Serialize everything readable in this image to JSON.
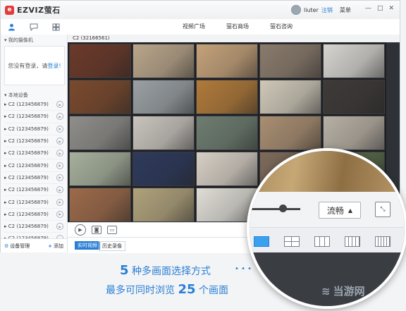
{
  "app": {
    "logo": "EZVIZ萤石",
    "username": "liuter",
    "logout": "注销",
    "menu": "菜单",
    "window_buttons": [
      "—",
      "□",
      "✕"
    ]
  },
  "nav": {
    "tabs": [
      "视频广场",
      "萤石商场",
      "萤石咨询"
    ]
  },
  "sidebar": {
    "my_cameras": "我的摄像机",
    "login_prompt": "您没有登录，请",
    "login_link": "登录!",
    "local_devices": "本地设备",
    "devices": [
      "C2 (123456879)",
      "C2 (123456879)",
      "C2 (123456879)",
      "C2 (123456879)",
      "C2 (123456879)",
      "C2 (123456879)",
      "C2 (123456879)",
      "C2 (123456879)",
      "C2 (123456879)",
      "C2 (123456879)",
      "C2 (123456879)",
      "C2 (123456879)"
    ],
    "device_manage": "设备管理",
    "add": "添加"
  },
  "main": {
    "camera_label": "C2 (32166561)",
    "tabs": {
      "live": "实时视频",
      "history": "历史录像"
    }
  },
  "grid": {
    "tile_colors": [
      "#6b3a2a",
      "#b9a58a",
      "#c4a27a",
      "#8a7b6c",
      "#d6d4cf",
      "#7a4a2e",
      "#9aa0a3",
      "#b07a3a",
      "#cfc8b8",
      "#3e3a38",
      "#8f8e8a",
      "#c9c4bd",
      "#6e7d70",
      "#a98e72",
      "#b8b0a4",
      "#a6b09c",
      "#2e3a5c",
      "#d7cfc5",
      "#7d6a5a",
      "#5a6b4a",
      "#9c6a4a",
      "#b0a27c",
      "#e0ddd6",
      "#8a7f72",
      "#c4b9a8"
    ]
  },
  "magnifier": {
    "quality": "流畅",
    "layouts": [
      "1",
      "4",
      "9",
      "16",
      "25"
    ]
  },
  "caption": {
    "line1_num": "5",
    "line1_text": " 种多画面选择方式",
    "line2_pre": "最多可同时浏览 ",
    "line2_num": "25",
    "line2_post": " 个画面"
  },
  "watermark": {
    "text": "当游网"
  }
}
